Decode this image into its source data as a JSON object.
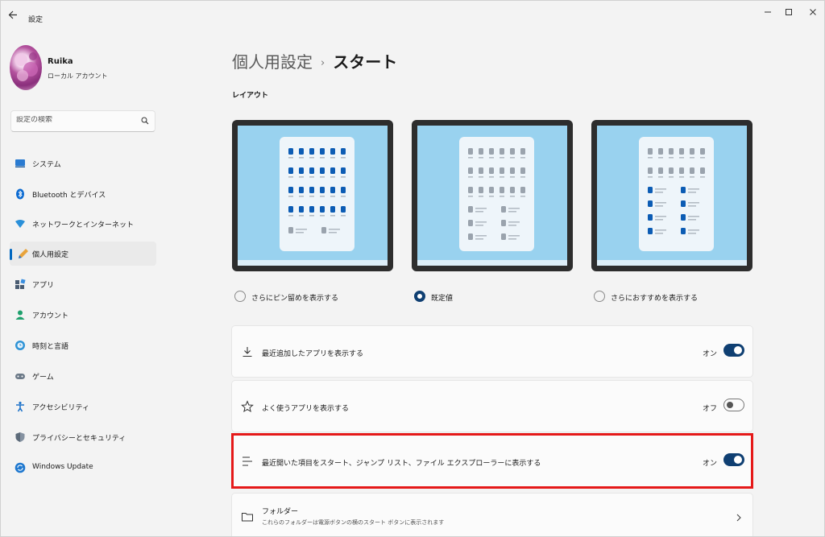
{
  "window": {
    "title": "設定"
  },
  "user": {
    "name": "Ruika",
    "account_type": "ローカル アカウント"
  },
  "search": {
    "placeholder": "設定の検索"
  },
  "nav": [
    {
      "label": "システム",
      "icon": "system-icon"
    },
    {
      "label": "Bluetooth とデバイス",
      "icon": "bluetooth-icon"
    },
    {
      "label": "ネットワークとインターネット",
      "icon": "network-icon"
    },
    {
      "label": "個人用設定",
      "icon": "personalization-icon",
      "active": true
    },
    {
      "label": "アプリ",
      "icon": "apps-icon"
    },
    {
      "label": "アカウント",
      "icon": "account-icon"
    },
    {
      "label": "時刻と言語",
      "icon": "time-language-icon"
    },
    {
      "label": "ゲーム",
      "icon": "gaming-icon"
    },
    {
      "label": "アクセシビリティ",
      "icon": "accessibility-icon"
    },
    {
      "label": "プライバシーとセキュリティ",
      "icon": "privacy-icon"
    },
    {
      "label": "Windows Update",
      "icon": "windows-update-icon"
    }
  ],
  "breadcrumb": {
    "parent": "個人用設定",
    "separator": "›",
    "current": "スタート"
  },
  "layout_section": {
    "title": "レイアウト",
    "options": [
      {
        "label": "さらにピン留めを表示する",
        "selected": false
      },
      {
        "label": "既定値",
        "selected": true
      },
      {
        "label": "さらにおすすめを表示する",
        "selected": false
      }
    ]
  },
  "settings": [
    {
      "label": "最近追加したアプリを表示する",
      "state": "オン",
      "on": true,
      "icon": "download-icon"
    },
    {
      "label": "よく使うアプリを表示する",
      "state": "オフ",
      "on": false,
      "icon": "star-icon"
    },
    {
      "label": "最近開いた項目をスタート、ジャンプ リスト、ファイル エクスプローラーに表示する",
      "state": "オン",
      "on": true,
      "icon": "list-icon"
    }
  ],
  "folders": {
    "label": "フォルダー",
    "description": "これらのフォルダーは電源ボタンの横のスタート ボタンに表示されます"
  },
  "colors": {
    "accent": "#0f3f72",
    "highlight": "#e51919",
    "layout_bg": "#99d2ef",
    "tile": "#0c5cb4"
  }
}
